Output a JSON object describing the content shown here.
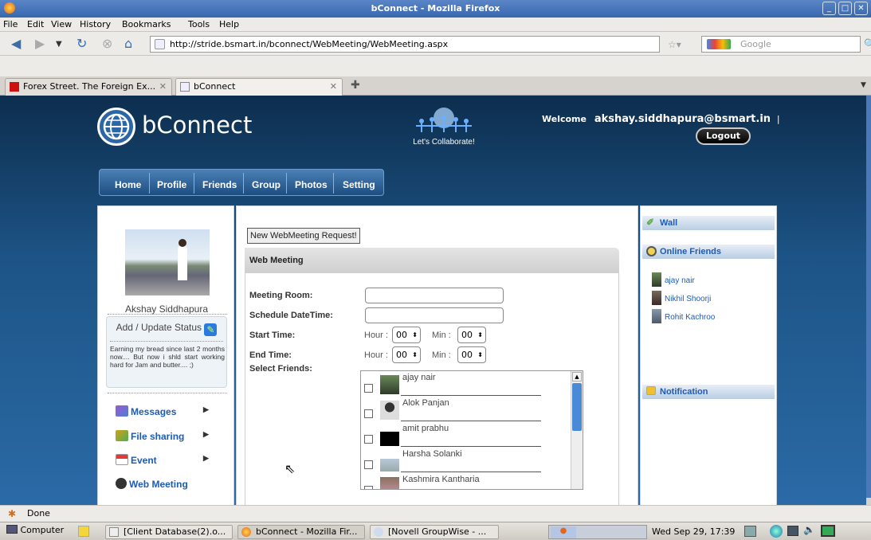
{
  "window": {
    "title": "bConnect - Mozilla Firefox"
  },
  "menu": [
    "File",
    "Edit",
    "View",
    "History",
    "Bookmarks",
    "Tools",
    "Help"
  ],
  "nav": {
    "url": "http://stride.bsmart.in/bconnect/WebMeeting/WebMeeting.aspx",
    "search_placeholder": "Google"
  },
  "tabs": [
    {
      "label": "Forex Street. The Foreign Ex...",
      "active": false
    },
    {
      "label": "bConnect",
      "active": true
    }
  ],
  "site": {
    "logo_text": "bConnect",
    "tagline": "Let's Collaborate!",
    "welcome_label": "Welcome",
    "user_email": "akshay.siddhapura@bsmart.in",
    "welcome_sep": "|",
    "logout_label": "Logout",
    "menu": [
      "Home",
      "Profile",
      "Friends",
      "Group",
      "Photos",
      "Setting"
    ]
  },
  "left": {
    "user_name": "Akshay Siddhapura",
    "status_button": "Add / Update Status",
    "status_text": "Earning my bread since last 2 months now.... But now i shld start working hard for Jam and butter.... ;)",
    "items": [
      {
        "label": "Messages",
        "icon": "messages-icon",
        "arrow": "▶"
      },
      {
        "label": "File sharing",
        "icon": "file-sharing-icon",
        "arrow": "▶"
      },
      {
        "label": "Event",
        "icon": "calendar-icon",
        "arrow": "▶"
      },
      {
        "label": "Web Meeting",
        "icon": "web-meeting-icon",
        "arrow": ""
      }
    ]
  },
  "center": {
    "request_button": "New WebMeeting Request!",
    "section_title": "Web Meeting",
    "meeting_room_label": "Meeting Room:",
    "schedule_label": "Schedule DateTime:",
    "start_label": "Start Time:",
    "end_label": "End Time:",
    "select_friends_label": "Select Friends:",
    "hour_label": "Hour :",
    "min_label": "Min :",
    "start_hour": "00",
    "start_min": "00",
    "end_hour": "00",
    "end_min": "00",
    "friends": [
      "ajay nair",
      "Alok Panjan",
      "amit prabhu",
      "Harsha Solanki",
      "Kashmira Kantharia"
    ]
  },
  "right": {
    "wall_label": "Wall",
    "online_label": "Online Friends",
    "online_friends": [
      "ajay nair",
      "Nikhil Shoorji",
      "Rohit Kachroo"
    ],
    "notification_label": "Notification"
  },
  "status": {
    "text": "Done"
  },
  "taskbar": {
    "computer_label": "Computer",
    "tasks": [
      "[Client Database(2).o...",
      "bConnect - Mozilla Fir...",
      "[Novell GroupWise - ..."
    ],
    "clock": "Wed Sep 29, 17:39"
  }
}
